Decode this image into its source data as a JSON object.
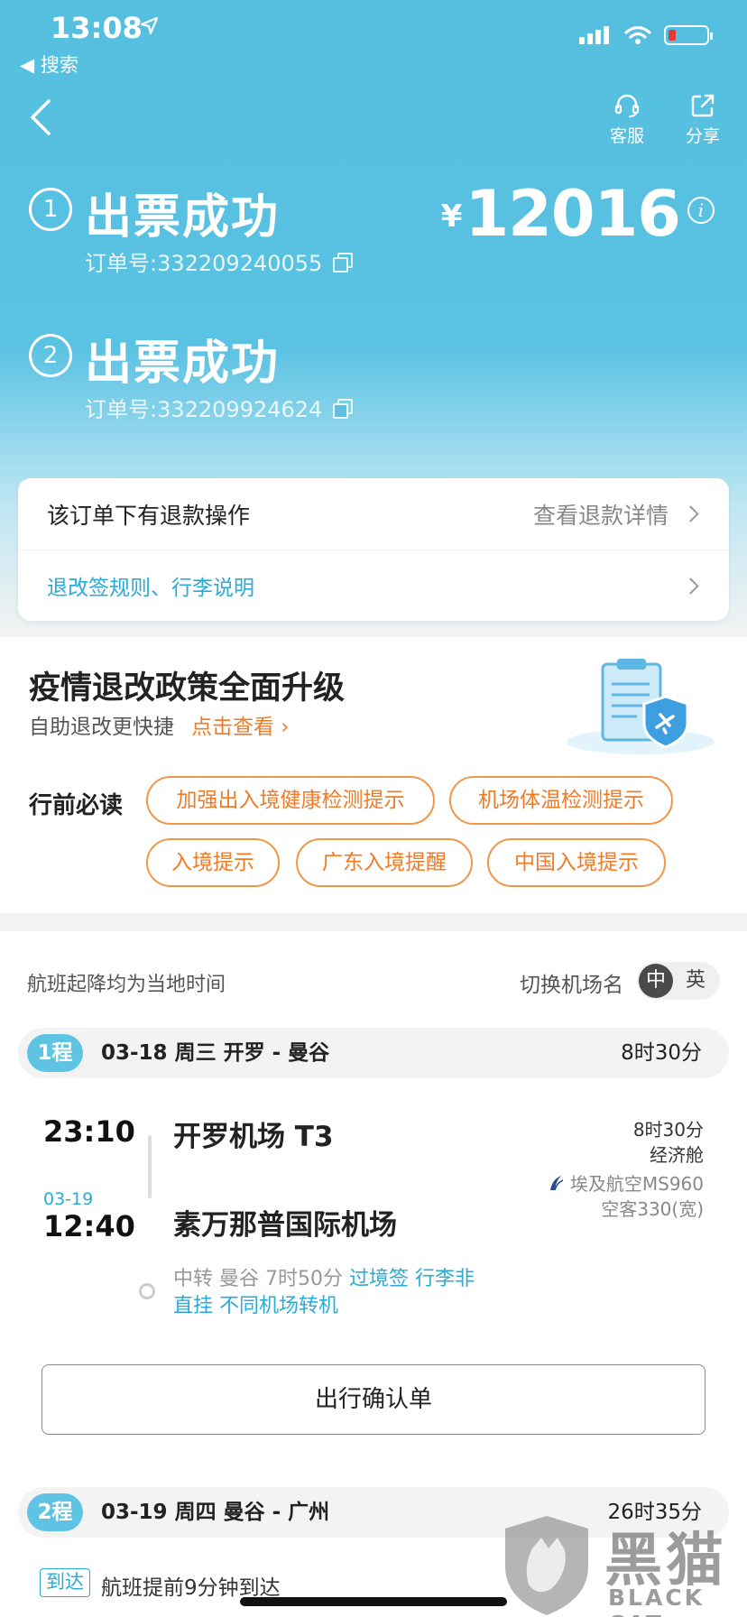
{
  "status_bar": {
    "time": "13:08",
    "back_app": "◀ 搜索"
  },
  "nav": {
    "service_label": "客服",
    "share_label": "分享"
  },
  "orders": [
    {
      "num": "1",
      "title": "出票成功",
      "order_no": "订单号:332209240055"
    },
    {
      "num": "2",
      "title": "出票成功",
      "order_no": "订单号:332209924624"
    }
  ],
  "price": {
    "currency": "¥",
    "amount": "12016"
  },
  "refund": {
    "text": "该订单下有退款操作",
    "detail_link": "查看退款详情",
    "rules_link": "退改签规则、行李说明"
  },
  "policy": {
    "title": "疫情退改政策全面升级",
    "subtitle": "自助退改更快捷",
    "link": "点击查看 ›",
    "must_read_label": "行前必读",
    "tags": [
      "加强出入境健康检测提示",
      "机场体温检测提示",
      "入境提示",
      "广东入境提醒",
      "中国入境提示"
    ]
  },
  "flights": {
    "local_time_note": "航班起降均为当地时间",
    "switch_label": "切换机场名",
    "lang_zh": "中",
    "lang_en": "英",
    "segments": [
      {
        "label": "1程",
        "info": "03-18  周三  开罗 - 曼谷",
        "duration": "8时30分"
      },
      {
        "label": "2程",
        "info": "03-19  周四  曼谷 - 广州",
        "duration": "26时35分"
      }
    ],
    "leg1": {
      "dep_time": "23:10",
      "dep_airport": "开罗机场 T3",
      "arr_date": "03-19",
      "arr_time": "12:40",
      "arr_airport": "素万那普国际机场",
      "duration": "8时30分",
      "cabin": "经济舱",
      "airline": "埃及航空MS960",
      "aircraft": "空客330(宽)",
      "transfer_prefix": "中转  曼谷 7时50分",
      "transfer_visa": "过境签",
      "transfer_luggage": "行李非",
      "transfer_line2": "直挂 不同机场转机"
    },
    "confirm_button": "出行确认单",
    "arrival_badge": "到达",
    "arrival_note": "航班提前9分钟到达"
  },
  "watermark": {
    "cn": "黑猫",
    "en": "BLACK CAT"
  },
  "colors": {
    "header_blue": "#5ac2e2",
    "accent_blue": "#2aaad6",
    "orange": "#ef7b27"
  }
}
